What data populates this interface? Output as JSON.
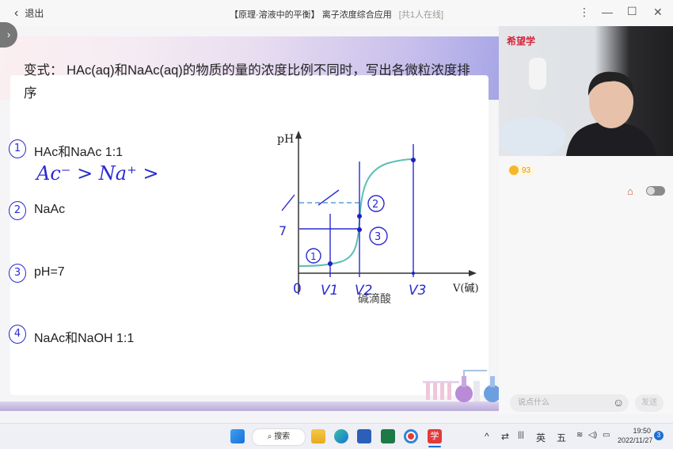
{
  "titlebar": {
    "back_label": "退出",
    "title": "【原理·溶液中的平衡】 离子浓度综合应用",
    "online": "[共1人在线]",
    "icons": [
      "more-icon",
      "minimize-icon",
      "maximize-icon",
      "close-icon"
    ]
  },
  "slide": {
    "question": "变式： HAc(aq)和NaAc(aq)的物质的量的浓度比例不同时，写出各微粒浓度排序",
    "items": [
      {
        "num": "1",
        "text": "HAc和NaAc 1:1"
      },
      {
        "num": "2",
        "text": "NaAc"
      },
      {
        "num": "3",
        "text": "pH=7"
      },
      {
        "num": "4",
        "text": "NaAc和NaOH 1:1"
      }
    ],
    "handwritten_answer": "Ac⁻ > Na⁺ >",
    "graph": {
      "y_label": "pH",
      "x_label": "V(碱)",
      "caption": "碱滴酸",
      "origin": "0",
      "x_marks": [
        "V1",
        "V2",
        "V3"
      ],
      "y_marks": [
        "7",
        "7"
      ],
      "point_labels": [
        "1",
        "2",
        "3"
      ],
      "curve_color": "#5bbfb5",
      "ink_color": "#2a2ad0"
    }
  },
  "sidebar": {
    "brand": "希望学",
    "coins": "93",
    "chat_placeholder": "说点什么",
    "send_label": "发送"
  },
  "taskbar": {
    "search_label": "搜索",
    "ime_lang": "英",
    "ime_mode": "五",
    "time": "19:50",
    "date": "2022/11/27",
    "notifications": "3"
  }
}
